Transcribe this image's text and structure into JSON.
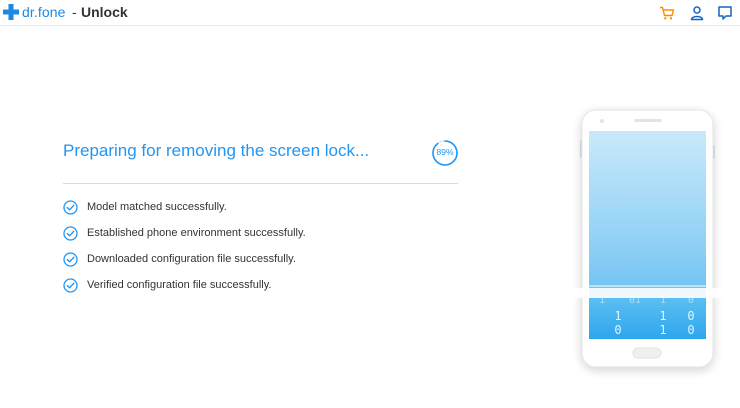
{
  "app": {
    "brand": "dr.fone",
    "separator": "-",
    "module": "Unlock"
  },
  "toolbar": {
    "icons": [
      "cart-icon",
      "user-icon",
      "feedback-icon"
    ]
  },
  "main": {
    "heading": "Preparing for removing the screen lock...",
    "progress_percent": 89,
    "progress_label": "89%",
    "steps": [
      {
        "label": "Model matched successfully.",
        "status": "done"
      },
      {
        "label": "Established phone environment successfully.",
        "status": "done"
      },
      {
        "label": "Downloaded configuration file successfully.",
        "status": "done"
      },
      {
        "label": "Verified configuration file successfully.",
        "status": "done"
      }
    ]
  },
  "illustration": {
    "binary_rows": [
      [
        "1",
        "0",
        "1",
        "1",
        "0"
      ],
      [
        "1",
        "1",
        "0"
      ],
      [
        "0",
        "1",
        "0"
      ]
    ]
  },
  "colors": {
    "accent": "#2196f3",
    "brand": "#1e88e5",
    "cart": "#ff8a00",
    "icon_dark": "#1565c0"
  }
}
